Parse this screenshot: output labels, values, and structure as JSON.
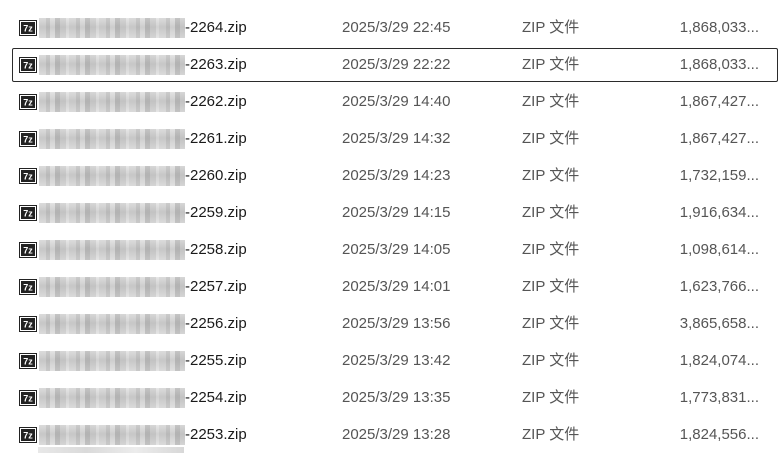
{
  "files": [
    {
      "name_suffix": "-2264.zip",
      "modified": "2025/3/29 22:45",
      "type": "ZIP 文件",
      "size": "1,868,033..."
    },
    {
      "name_suffix": "-2263.zip",
      "modified": "2025/3/29 22:22",
      "type": "ZIP 文件",
      "size": "1,868,033..."
    },
    {
      "name_suffix": "-2262.zip",
      "modified": "2025/3/29 14:40",
      "type": "ZIP 文件",
      "size": "1,867,427..."
    },
    {
      "name_suffix": "-2261.zip",
      "modified": "2025/3/29 14:32",
      "type": "ZIP 文件",
      "size": "1,867,427..."
    },
    {
      "name_suffix": "-2260.zip",
      "modified": "2025/3/29 14:23",
      "type": "ZIP 文件",
      "size": "1,732,159..."
    },
    {
      "name_suffix": "-2259.zip",
      "modified": "2025/3/29 14:15",
      "type": "ZIP 文件",
      "size": "1,916,634..."
    },
    {
      "name_suffix": "-2258.zip",
      "modified": "2025/3/29 14:05",
      "type": "ZIP 文件",
      "size": "1,098,614..."
    },
    {
      "name_suffix": "-2257.zip",
      "modified": "2025/3/29 14:01",
      "type": "ZIP 文件",
      "size": "1,623,766..."
    },
    {
      "name_suffix": "-2256.zip",
      "modified": "2025/3/29 13:56",
      "type": "ZIP 文件",
      "size": "3,865,658..."
    },
    {
      "name_suffix": "-2255.zip",
      "modified": "2025/3/29 13:42",
      "type": "ZIP 文件",
      "size": "1,824,074..."
    },
    {
      "name_suffix": "-2254.zip",
      "modified": "2025/3/29 13:35",
      "type": "ZIP 文件",
      "size": "1,773,831..."
    },
    {
      "name_suffix": "-2253.zip",
      "modified": "2025/3/29 13:28",
      "type": "ZIP 文件",
      "size": "1,824,556..."
    }
  ],
  "icon": {
    "name": "7z-archive-icon",
    "glyph": "7z"
  },
  "colors": {
    "selection_border": "#2b2b2b",
    "secondary_text": "#555555"
  }
}
